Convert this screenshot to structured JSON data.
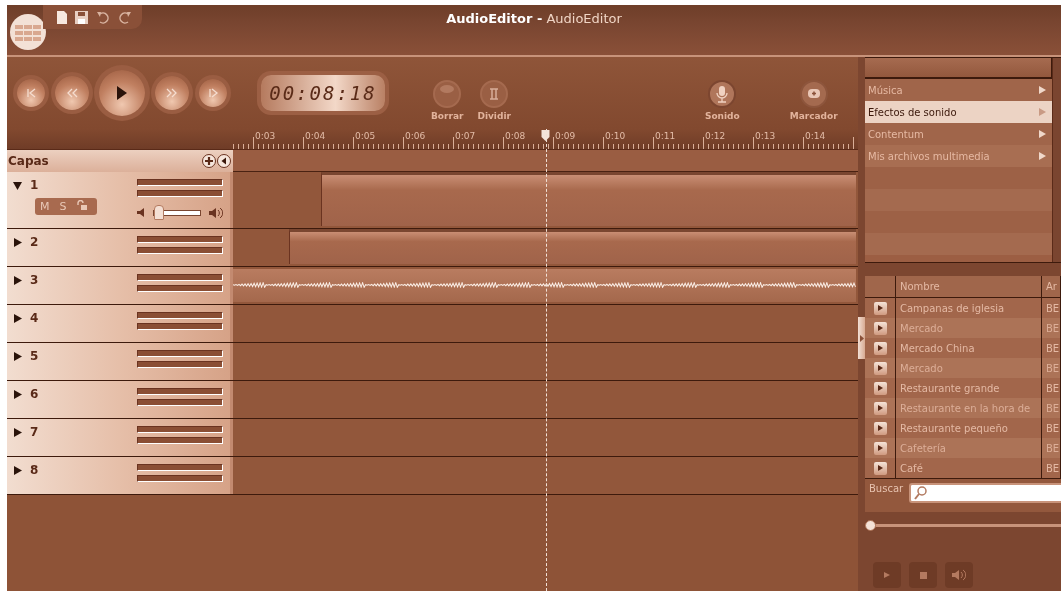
{
  "window": {
    "title": "**AudioEditor -** AudioEditor"
  },
  "transport": {
    "buttons": [
      {
        "kind": "start"
      },
      {
        "kind": "rewind"
      },
      {
        "kind": "play"
      },
      {
        "kind": "forward"
      },
      {
        "kind": "end"
      }
    ],
    "time": "00:08:18",
    "tools": [
      {
        "label": "Borrar",
        "kind": "erase"
      },
      {
        "label": "Dividir",
        "kind": "split"
      },
      {
        "label": "Sonido",
        "kind": "mic"
      },
      {
        "label": "Marcador",
        "kind": "marker"
      }
    ]
  },
  "ruler": {
    "labels": [
      "0:03",
      "0:04",
      "0:05",
      "0:06",
      "0:07",
      "0:08",
      "0:09",
      "0:10",
      "0:11",
      "0:12",
      "0:13",
      "0:14"
    ],
    "playhead": {
      "level": 0.5
    }
  },
  "layers": {
    "title": "Capas",
    "rows": [
      {
        "label": "1",
        "expanded": true,
        "controls": [
          "M",
          "S"
        ],
        "volume": {
          "level": 0.1
        },
        "clip": {
          "kind": "region"
        }
      },
      {
        "label": "2",
        "expanded": false,
        "clip": {
          "kind": "region"
        }
      },
      {
        "label": "3",
        "expanded": false,
        "clip": {
          "kind": "waveform"
        }
      },
      {
        "label": "4",
        "expanded": false,
        "clip": {
          "kind": "none"
        }
      },
      {
        "label": "5",
        "expanded": false,
        "clip": {
          "kind": "none"
        }
      },
      {
        "label": "6",
        "expanded": false,
        "clip": {
          "kind": "none"
        }
      },
      {
        "label": "7",
        "expanded": false,
        "clip": {
          "kind": "none"
        }
      },
      {
        "label": "8",
        "expanded": false,
        "clip": {
          "kind": "none"
        }
      }
    ]
  },
  "library": {
    "categories": [
      {
        "label": "Música",
        "selected": false
      },
      {
        "label": "Efectos de sonido",
        "selected": true
      },
      {
        "label": "Contentum",
        "selected": false
      },
      {
        "label": "Mis archivos multimedia",
        "selected": false
      }
    ],
    "table": {
      "columns": [
        "Nombre",
        "Ar"
      ],
      "rows": [
        {
          "nombre": "Campanas de iglesia",
          "column_3": "BE"
        },
        {
          "nombre": "Mercado",
          "column_3": "BE"
        },
        {
          "nombre": "Mercado China",
          "column_3": "BE"
        },
        {
          "nombre": "Mercado",
          "column_3": "BE"
        },
        {
          "nombre": "Restaurante grande",
          "column_3": "BE"
        },
        {
          "nombre": "Restaurante en la hora de",
          "column_3": "BE"
        },
        {
          "nombre": "Restaurante pequeño",
          "column_3": "BE"
        },
        {
          "nombre": "Cafetería",
          "column_3": "BE"
        },
        {
          "nombre": "Café",
          "column_3": "BE"
        }
      ]
    },
    "search": {
      "label": "Buscar"
    },
    "player": {
      "level": 0
    }
  }
}
